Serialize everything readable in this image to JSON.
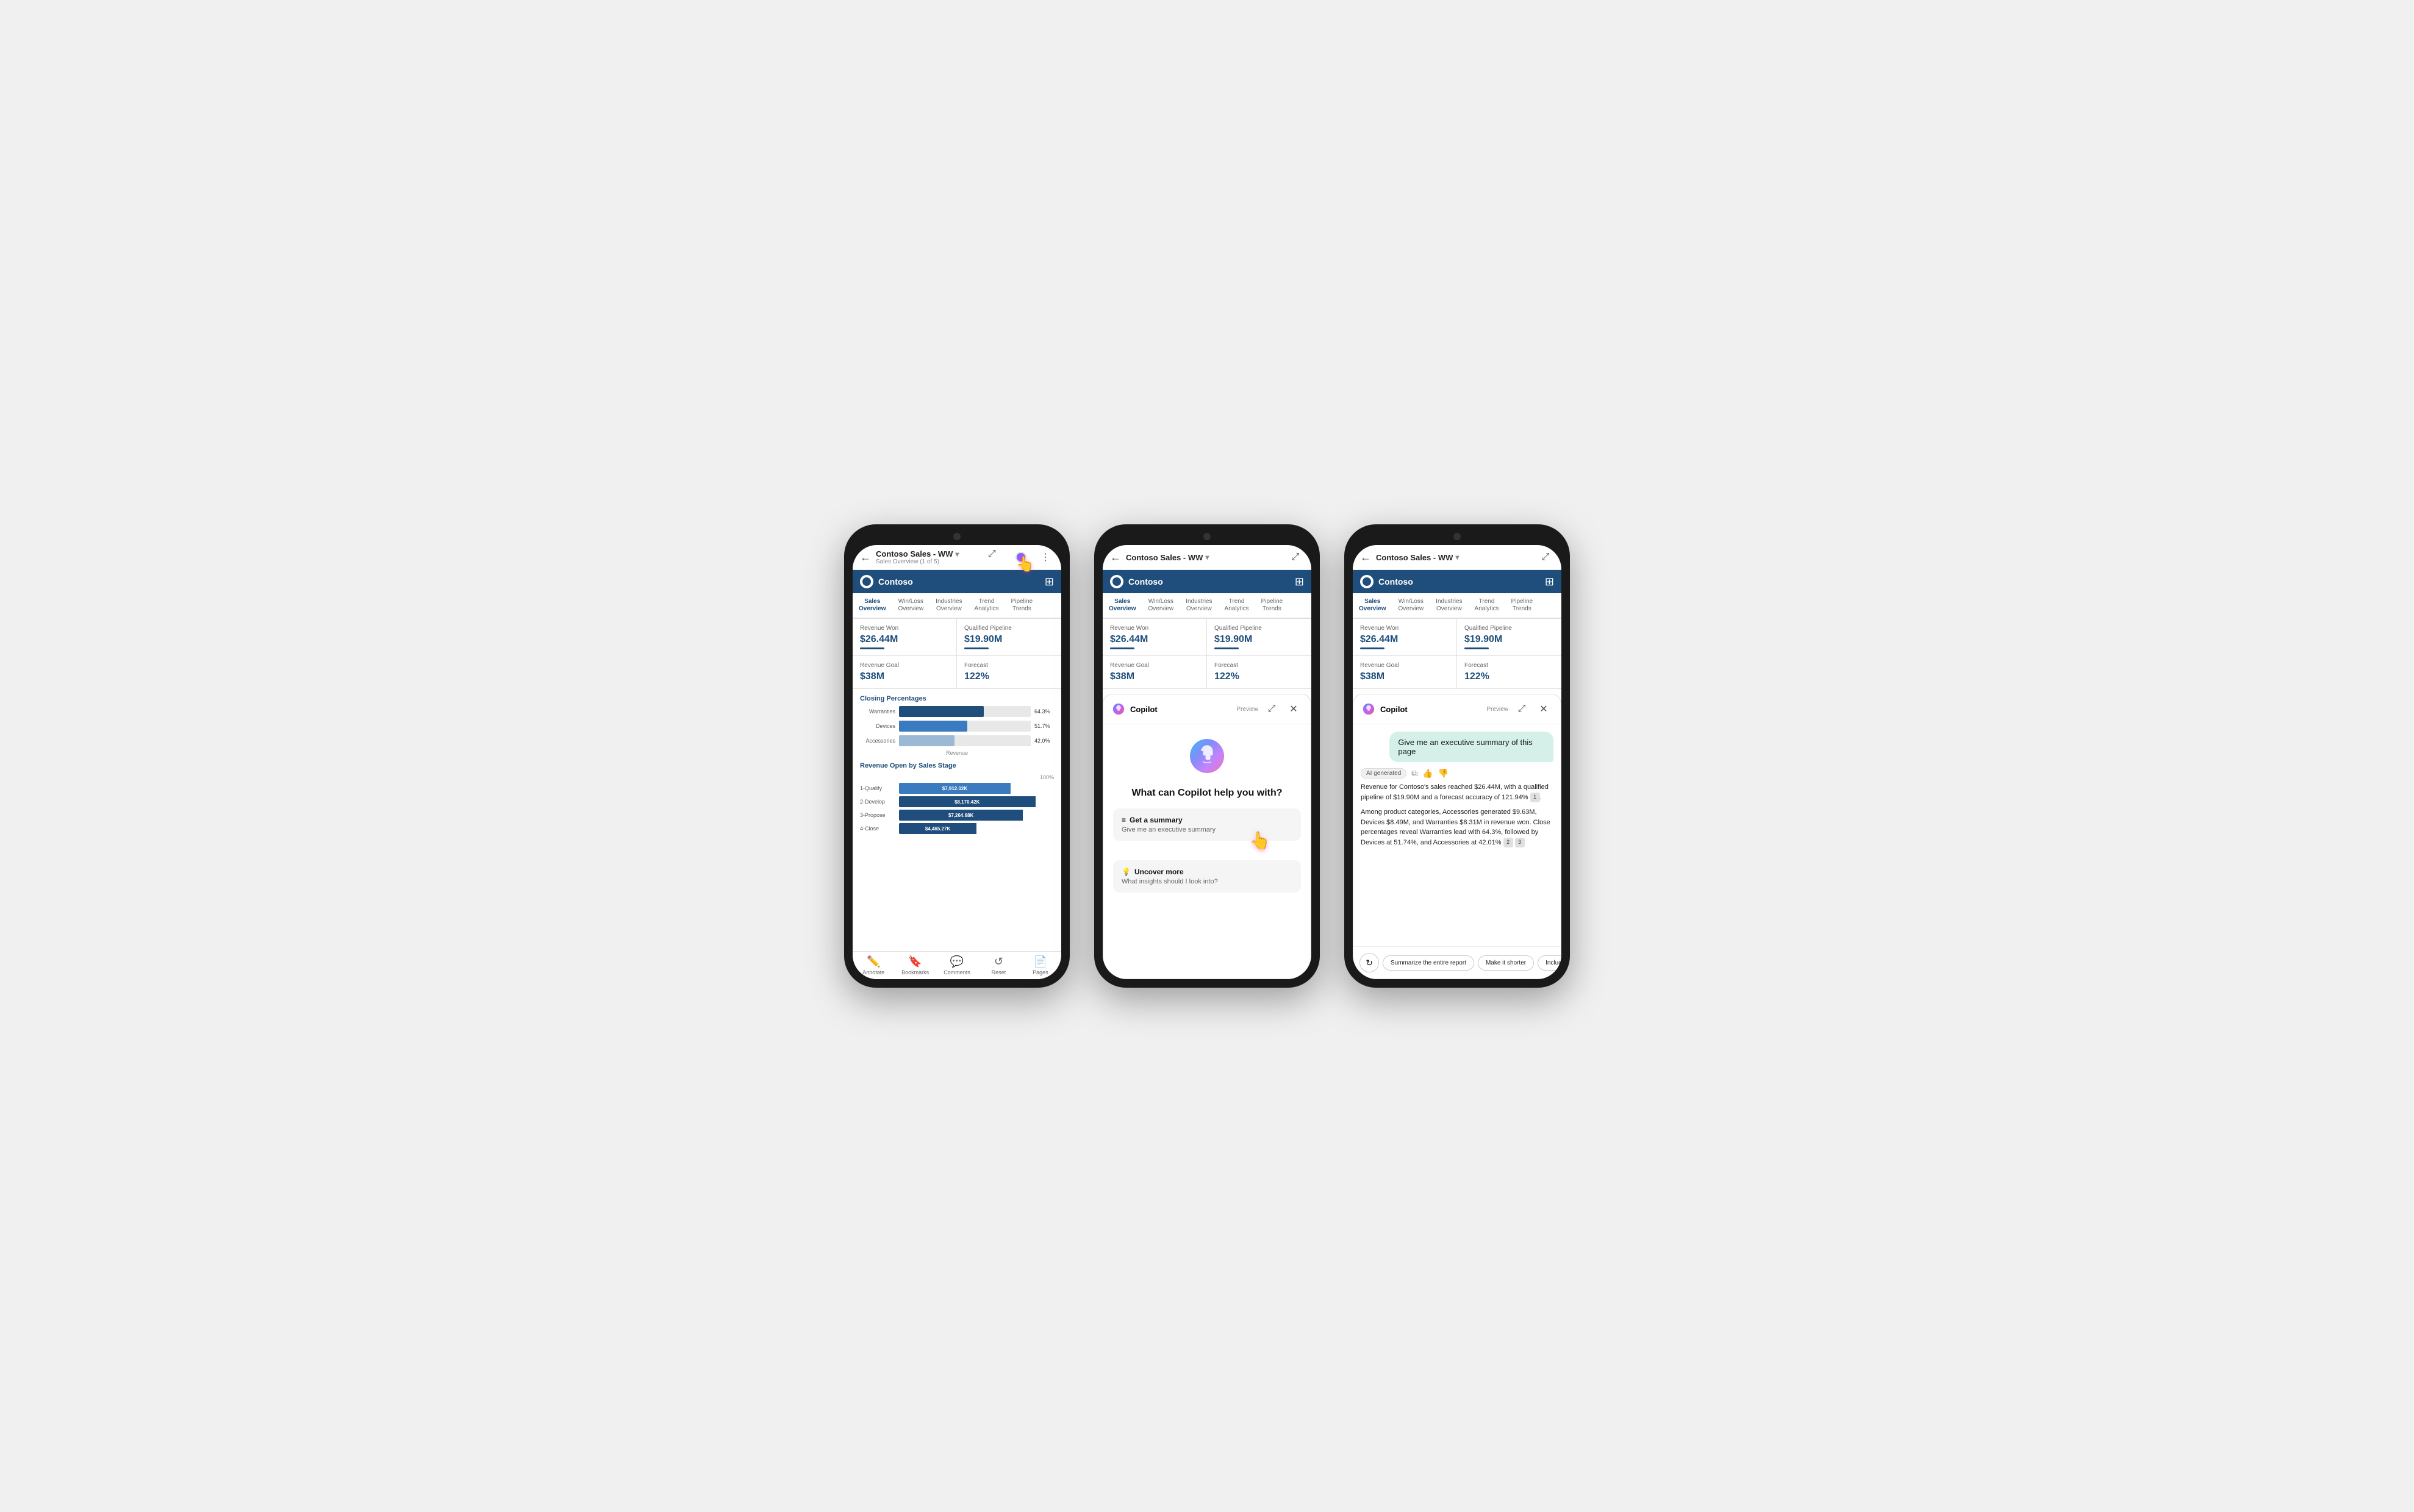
{
  "phone1": {
    "nav": {
      "back": "←",
      "title": "Contoso Sales - WW",
      "subtitle": "Sales Overview (1 of 5)",
      "icon_expand": "⤢",
      "icon_filter": "⧉",
      "icon_more": "⋮"
    },
    "contoso": {
      "name": "Contoso",
      "filter_icon": "⊞"
    },
    "tabs": [
      {
        "label": "Sales\nOverview",
        "active": true
      },
      {
        "label": "Win/Loss\nOverview",
        "active": false
      },
      {
        "label": "Industries\nOverview",
        "active": false
      },
      {
        "label": "Trend\nAnalytics",
        "active": false
      },
      {
        "label": "Pipeline\nTrends",
        "active": false
      }
    ],
    "metrics": [
      {
        "label": "Revenue Won",
        "value": "$26.44M"
      },
      {
        "label": "Qualified Pipeline",
        "value": "$19.90M"
      },
      {
        "label": "Revenue Goal",
        "value": "$38M"
      },
      {
        "label": "Forecast",
        "value": "122%"
      }
    ],
    "closing_title": "Closing Percentages",
    "bars": [
      {
        "label": "Warranties",
        "pct": 64.3,
        "display": "64.3%",
        "style": "dark"
      },
      {
        "label": "Devices",
        "pct": 51.7,
        "display": "51.7%",
        "style": "mid"
      },
      {
        "label": "Accessories",
        "pct": 42.0,
        "display": "42.0%",
        "style": "light"
      }
    ],
    "bar_xlabel": "Revenue",
    "revenue_title": "Revenue Open by Sales Stage",
    "stacked_header": "100%",
    "stacked_rows": [
      {
        "label": "1-Qualify",
        "value": "$7,912.02K",
        "pct": 72
      },
      {
        "label": "2-Develop",
        "value": "$8,170.42K",
        "pct": 88
      },
      {
        "label": "3-Propose",
        "value": "$7,264.68K",
        "pct": 80
      },
      {
        "label": "4-Close",
        "value": "$4,465.27K",
        "pct": 50
      }
    ],
    "bottom_nav": [
      {
        "icon": "✏️",
        "label": "Annotate"
      },
      {
        "icon": "🔖",
        "label": "Bookmarks"
      },
      {
        "icon": "💬",
        "label": "Comments"
      },
      {
        "icon": "↺",
        "label": "Reset"
      },
      {
        "icon": "📄",
        "label": "Pages"
      }
    ]
  },
  "phone2": {
    "nav": {
      "back": "←",
      "title": "Contoso Sales - WW",
      "icon_expand": "⤢"
    },
    "contoso": {
      "name": "Contoso"
    },
    "tabs": [
      {
        "label": "Sales\nOverview",
        "active": true
      },
      {
        "label": "Win/Loss\nOverview",
        "active": false
      },
      {
        "label": "Industries\nOverview",
        "active": false
      },
      {
        "label": "Trend\nAnalytics",
        "active": false
      },
      {
        "label": "Pipeline\nTrends",
        "active": false
      }
    ],
    "metrics": [
      {
        "label": "Revenue Won",
        "value": "$26.44M"
      },
      {
        "label": "Qualified Pipeline",
        "value": "$19.90M"
      },
      {
        "label": "Revenue Goal",
        "value": "$38M"
      },
      {
        "label": "Forecast",
        "value": "122%"
      }
    ],
    "copilot": {
      "title": "Copilot",
      "preview": "Preview",
      "big_question": "What can Copilot help you with?",
      "expand": "⤢",
      "close": "✕",
      "suggestions": [
        {
          "icon": "≡",
          "title": "Get a summary",
          "subtitle": "Give me an executive summary"
        },
        {
          "icon": "💡",
          "title": "Uncover more",
          "subtitle": "What insights should I look into?"
        }
      ]
    }
  },
  "phone3": {
    "nav": {
      "back": "←",
      "title": "Contoso Sales - WW",
      "icon_expand": "⤢"
    },
    "contoso": {
      "name": "Contoso"
    },
    "tabs": [
      {
        "label": "Sales\nOverview",
        "active": true
      },
      {
        "label": "Win/Loss\nOverview",
        "active": false
      },
      {
        "label": "Industries\nOverview",
        "active": false
      },
      {
        "label": "Trend\nAnalytics",
        "active": false
      },
      {
        "label": "Pipeline\nTrends",
        "active": false
      }
    ],
    "metrics": [
      {
        "label": "Revenue Won",
        "value": "$26.44M"
      },
      {
        "label": "Qualified Pipeline",
        "value": "$19.90M"
      },
      {
        "label": "Revenue Goal",
        "value": "$38M"
      },
      {
        "label": "Forecast",
        "value": "122%"
      }
    ],
    "copilot": {
      "title": "Copilot",
      "preview": "Preview",
      "expand": "⤢",
      "close": "✕"
    },
    "chat": {
      "user_msg": "Give me an executive summary of this page",
      "ai_badge": "AI generated",
      "response_p1": "Revenue for Contoso's sales reached $26.44M, with a qualified pipeline of $19.90M and a forecast accuracy of 121.94%",
      "response_p2": "Among product categories, Accessories generated $9.63M, Devices $8.49M, and Warranties $8.31M in revenue won. Close percentages reveal Warranties lead with 64.3%, followed by Devices at 51.74%, and Accessories at 42.01%",
      "cite1": "1",
      "cite2": "2",
      "cite3": "3"
    },
    "actions": [
      {
        "label": "Summarize the entire report"
      },
      {
        "label": "Make it shorter"
      },
      {
        "label": "Include more details"
      }
    ],
    "refresh": "↻"
  }
}
